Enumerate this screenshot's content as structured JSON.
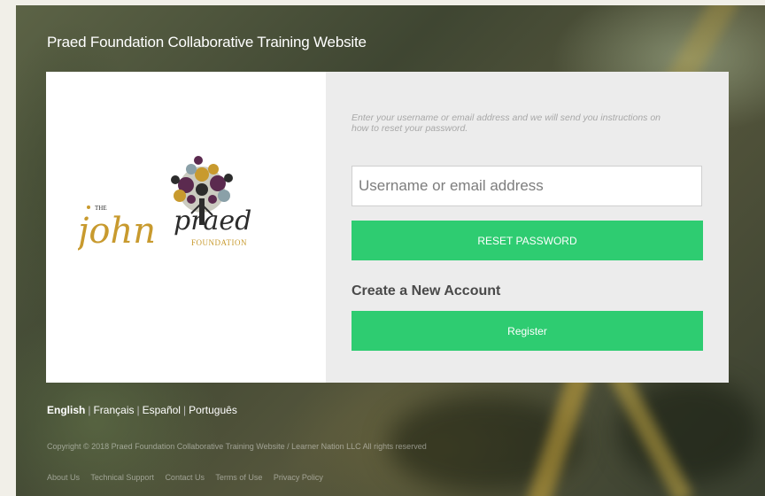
{
  "header": {
    "site_title": "Praed Foundation Collaborative Training Website"
  },
  "logo": {
    "the_text": "THE",
    "john_text": "john",
    "praed_text": "praed",
    "foundation_text": "FOUNDATION",
    "colors": {
      "gold": "#c89a2e",
      "purple": "#5b2a4f",
      "dark": "#2c2c2c"
    }
  },
  "reset_form": {
    "instructions": "Enter your username or email address and we will send you instructions on how to reset your password.",
    "input_placeholder": "Username or email address",
    "input_value": "",
    "reset_button_label": "RESET PASSWORD"
  },
  "create_account": {
    "heading": "Create a New Account",
    "register_button_label": "Register"
  },
  "languages": [
    {
      "label": "English",
      "active": true
    },
    {
      "label": "Français",
      "active": false
    },
    {
      "label": "Español",
      "active": false
    },
    {
      "label": "Português",
      "active": false
    }
  ],
  "footer": {
    "copyright": "Copyright © 2018 Praed Foundation Collaborative Training Website / Learner Nation LLC All rights reserved",
    "links": [
      "About Us",
      "Technical Support",
      "Contact Us",
      "Terms of Use",
      "Privacy Policy"
    ]
  },
  "colors": {
    "accent_green": "#2ecc71",
    "panel_gray": "#ececec"
  }
}
